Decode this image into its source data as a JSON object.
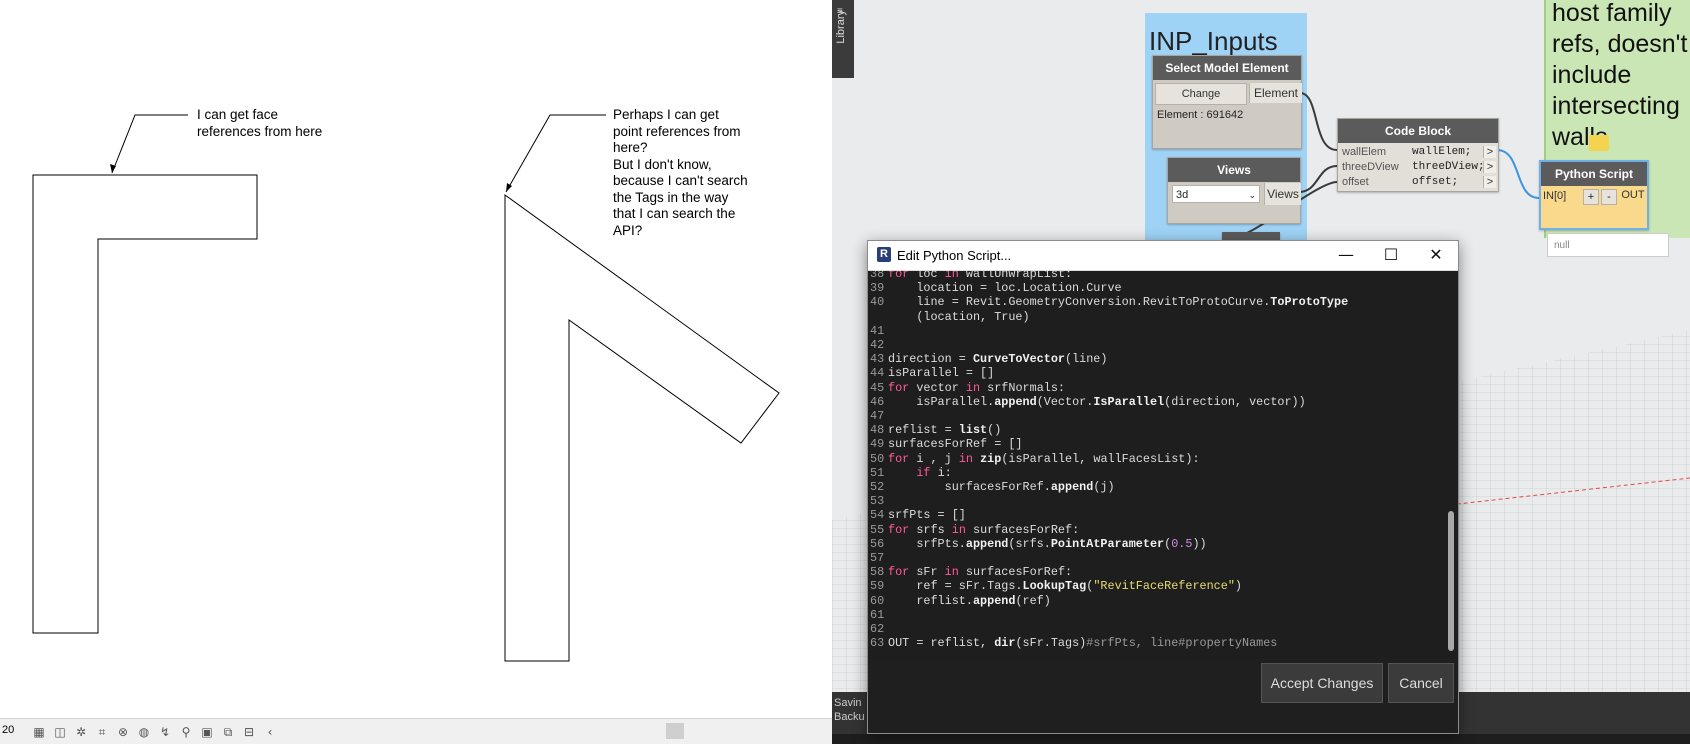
{
  "revit": {
    "note1": "I can get face\nreferences from here",
    "note2": "Perhaps I can get\npoint references from\nhere?\nBut I don't know,\nbecause I can't search\nthe Tags in the way\nthat I can search the\nAPI?",
    "scale": "20",
    "status_icons": [
      "grid-icon",
      "cube-icon",
      "sun-icon",
      "crop-icon",
      "hide-icon",
      "render-icon",
      "path-icon",
      "pin-icon",
      "view-icon",
      "link-icon",
      "constraint-icon",
      "chevron-left-icon"
    ]
  },
  "dynamo": {
    "library_label": "Library",
    "group_inputs_title": "INP_Inputs",
    "group_note_text": "host family refs, doesn't include intersecting walls",
    "select_model_element": {
      "title": "Select Model Element",
      "change_label": "Change",
      "output_label": "Element",
      "info": "Element : 691642"
    },
    "views_node": {
      "title": "Views",
      "selected": "3d",
      "output_label": "Views"
    },
    "code_block": {
      "title": "Code Block",
      "rows": [
        {
          "in": "wallElem",
          "code": "wallElem;",
          "out": ">"
        },
        {
          "in": "threeDView",
          "code": "threeDView;",
          "out": ">"
        },
        {
          "in": "offset",
          "code": "offset;",
          "out": ">"
        }
      ]
    },
    "python_script": {
      "title": "Python Script",
      "input": "IN[0]",
      "plus": "+",
      "minus": "-",
      "output": "OUT",
      "preview": "null"
    },
    "status_text": "Savin\nBacku"
  },
  "editor": {
    "title": "Edit Python Script...",
    "minimize": "—",
    "maximize": "☐",
    "close": "✕",
    "accept_label": "Accept Changes",
    "cancel_label": "Cancel",
    "lines": [
      {
        "n": "38",
        "c": "for loc in wallUnwrapList:"
      },
      {
        "n": "39",
        "c": "    location = loc.Location.Curve"
      },
      {
        "n": "40",
        "c": "    line = Revit.GeometryConversion.RevitToProtoCurve.ToProtoType"
      },
      {
        "n": "",
        "c": "    (location, True)"
      },
      {
        "n": "41",
        "c": ""
      },
      {
        "n": "42",
        "c": ""
      },
      {
        "n": "43",
        "c": "direction = CurveToVector(line)"
      },
      {
        "n": "44",
        "c": "isParallel = []"
      },
      {
        "n": "45",
        "c": "for vector in srfNormals:"
      },
      {
        "n": "46",
        "c": "    isParallel.append(Vector.IsParallel(direction, vector))"
      },
      {
        "n": "47",
        "c": ""
      },
      {
        "n": "48",
        "c": "reflist = list()"
      },
      {
        "n": "49",
        "c": "surfacesForRef = []"
      },
      {
        "n": "50",
        "c": "for i , j in zip(isParallel, wallFacesList):"
      },
      {
        "n": "51",
        "c": "    if i:"
      },
      {
        "n": "52",
        "c": "        surfacesForRef.append(j)"
      },
      {
        "n": "53",
        "c": ""
      },
      {
        "n": "54",
        "c": "srfPts = []"
      },
      {
        "n": "55",
        "c": "for srfs in surfacesForRef:"
      },
      {
        "n": "56",
        "c": "    srfPts.append(srfs.PointAtParameter(0.5))"
      },
      {
        "n": "57",
        "c": ""
      },
      {
        "n": "58",
        "c": "for sFr in surfacesForRef:"
      },
      {
        "n": "59",
        "c": "    ref = sFr.Tags.LookupTag(\"RevitFaceReference\")"
      },
      {
        "n": "60",
        "c": "    reflist.append(ref)"
      },
      {
        "n": "61",
        "c": ""
      },
      {
        "n": "62",
        "c": ""
      },
      {
        "n": "63",
        "c": "OUT = reflist, dir(sFr.Tags)#srfPts, line#propertyNames"
      }
    ]
  }
}
